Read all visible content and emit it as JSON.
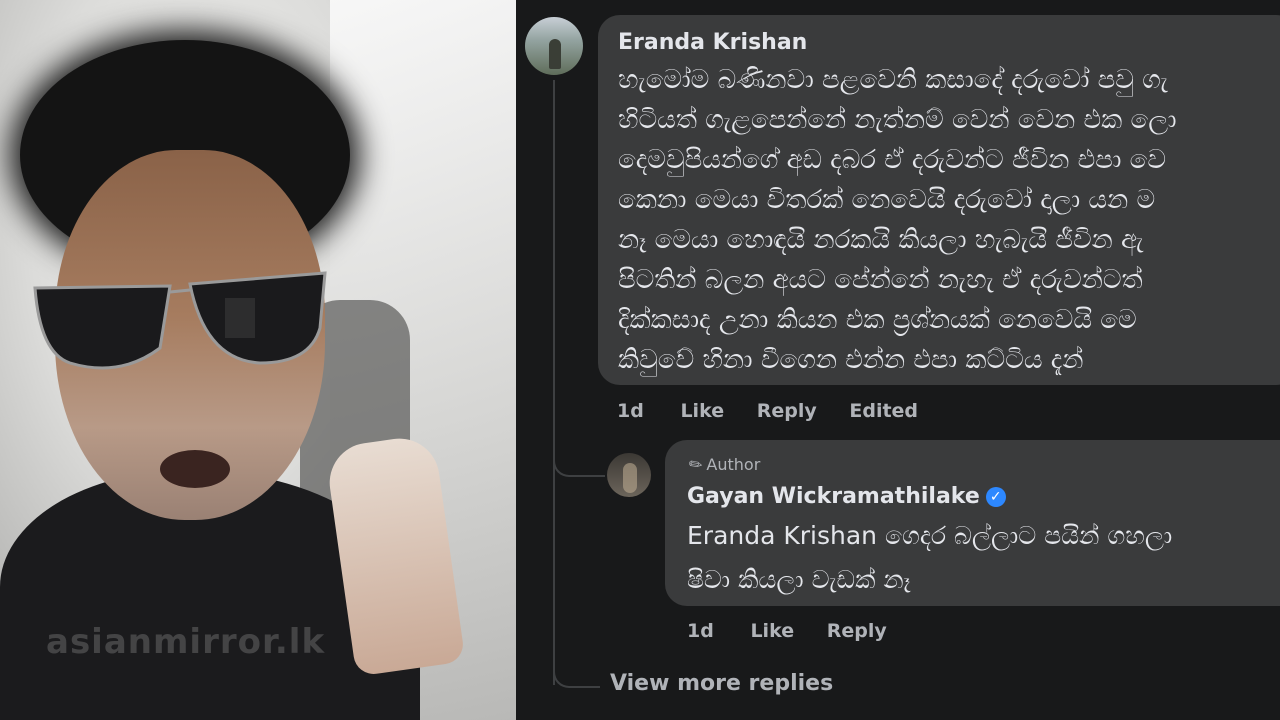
{
  "watermark": "asianmirror.lk",
  "comment": {
    "author": "Eranda Krishan",
    "lines": [
      "හැමෝම බණිනවා පළවෙනි කසාදේ දරුවෝ පවු ගැ",
      "හිටියත් ගැළපෙන්නේ නැත්නම් වෙන් වෙන එක ලො",
      "දෙමවුපියන්ගේ අඩ දබර ඒ දරුවන්ට ජීවින එපා වෙ",
      "කෙනා මෙයා විතරක් නෙවෙයි දරුවෝ දාලා යන ම",
      "නෑ මෙයා හොඳයි නරකයි කියලා හැබැයි ජීවින ඇ",
      "පිටතින් බලන අයට පේන්නේ නැහැ ඒ දරුවන්ටත්",
      "දික්කසාද උනා කියන එක ප්‍රශ්නයක් නෙවෙයි මෙ",
      "කිවුවේ හිනා වීගෙන එන්න එපා කට්ටිය දැන්"
    ],
    "time": "1d",
    "like": "Like",
    "reply": "Reply",
    "edited": "Edited"
  },
  "reply": {
    "author_badge": "Author",
    "author": "Gayan Wickramathilake",
    "lines": [
      "Eranda Krishan ගෙදර බල්ලාට පයින් ගහලා",
      "ෂිවා කියලා වැඩක් නෑ"
    ],
    "time": "1d",
    "like": "Like",
    "reply": "Reply"
  },
  "view_more": "View more replies"
}
